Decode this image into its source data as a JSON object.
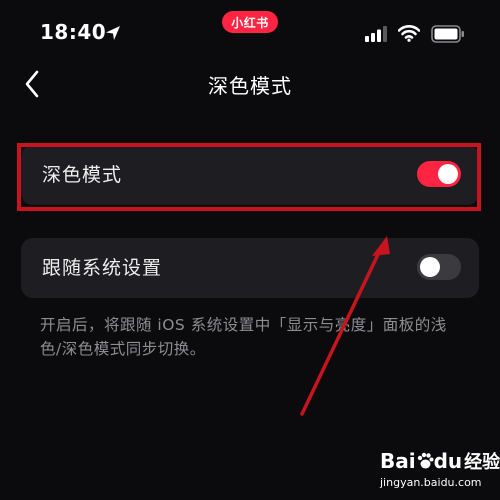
{
  "status_bar": {
    "time": "18:40",
    "app_badge": "小红书"
  },
  "nav": {
    "title": "深色模式"
  },
  "settings": [
    {
      "label": "深色模式",
      "enabled": true
    },
    {
      "label": "跟随系统设置",
      "enabled": false
    }
  ],
  "hint": "开启后，将跟随 iOS 系统设置中「显示与亮度」面板的浅色/深色模式同步切换。",
  "colors": {
    "accent": "#ff2442",
    "highlight": "#c8141e",
    "background": "#0b0b0d",
    "card": "#1e1e22"
  },
  "watermark": {
    "logo_bai": "Bai",
    "logo_du": "du",
    "logo_jingyan": "经验",
    "url": "jingyan.baidu.com"
  }
}
